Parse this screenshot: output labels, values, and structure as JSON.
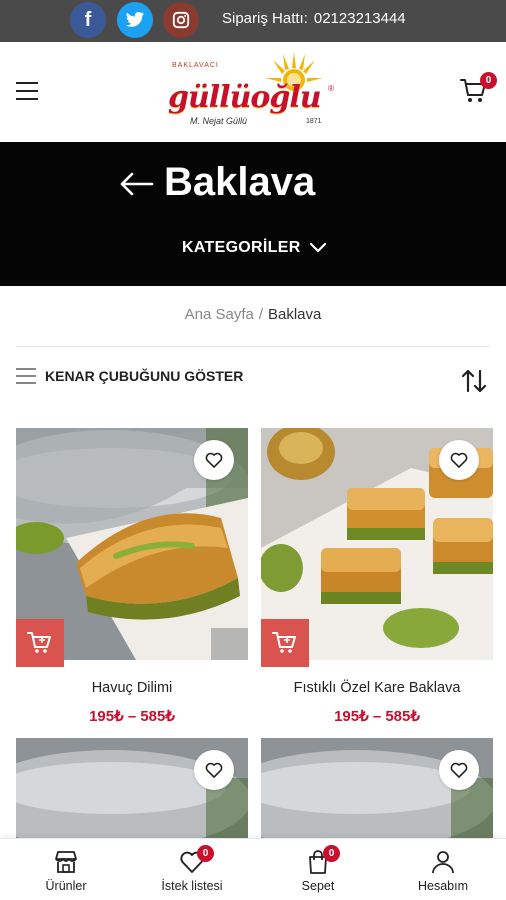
{
  "topbar": {
    "social": [
      {
        "icon": "facebook-icon",
        "glyph": "f",
        "color": "#3b5998"
      },
      {
        "icon": "twitter-icon",
        "color": "#1da1f2"
      },
      {
        "icon": "instagram-icon",
        "color": "#8a3a2e"
      }
    ],
    "hotline_label": "Sipariş Hattı:",
    "hotline_number": "02123213444"
  },
  "header": {
    "menu_icon": "hamburger-menu-icon",
    "logo": {
      "small_text": "BAKLAVACI",
      "brand": "güllüoğlu",
      "signature": "M. Nejat Güllü",
      "year": "1871",
      "reg": "®"
    },
    "cart_icon": "cart-icon",
    "cart_count": "0"
  },
  "hero": {
    "title": "Baklava",
    "categories_label": "KATEGORİLER",
    "background": "#050505"
  },
  "breadcrumb": {
    "home": "Ana Sayfa",
    "separator": "/",
    "current": "Baklava"
  },
  "toolbar": {
    "sidebar_label": "KENAR ÇUBUĞUNU GÖSTER",
    "sort_icon": "sort-icon"
  },
  "products": [
    {
      "name": "Havuç Dilimi",
      "price": "195₺ – 585₺"
    },
    {
      "name": "Fıstıklı Özel Kare Baklava",
      "price": "195₺ – 585₺"
    },
    {
      "name": "",
      "price": ""
    },
    {
      "name": "",
      "price": ""
    }
  ],
  "bottom_nav": [
    {
      "label": "Ürünler",
      "icon": "store-icon"
    },
    {
      "label": "İstek listesi",
      "icon": "heart-icon",
      "badge": "0"
    },
    {
      "label": "Sepet",
      "icon": "shopping-bag-icon",
      "badge": "0"
    },
    {
      "label": "Hesabım",
      "icon": "user-icon"
    }
  ],
  "colors": {
    "accent_red": "#c8102e",
    "add_to_cart_bg": "#d9534f",
    "topbar_bg": "#4a4a4a"
  }
}
